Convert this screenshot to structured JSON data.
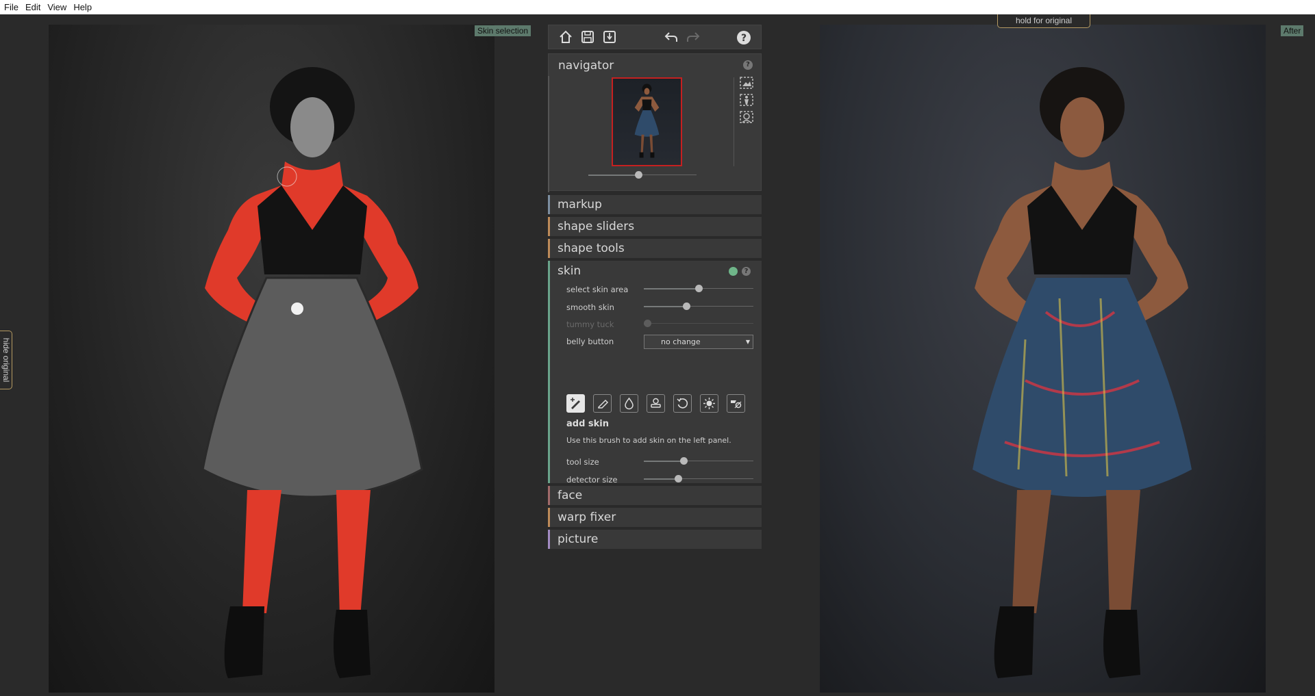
{
  "menu": [
    "File",
    "Edit",
    "View",
    "Help"
  ],
  "labels": {
    "skin_selection": "Skin selection",
    "after": "After",
    "hold_original": "hold for original",
    "hide_original": "hide original"
  },
  "panel": {
    "navigator": {
      "title": "navigator",
      "zoom_level": 0.46
    },
    "sections": {
      "markup": "markup",
      "shape_sliders": "shape sliders",
      "shape_tools": "shape tools",
      "skin": "skin",
      "face": "face",
      "warp_fixer": "warp fixer",
      "picture": "picture"
    },
    "skin": {
      "select_skin_area": {
        "label": "select skin area",
        "value": 0.5
      },
      "smooth_skin": {
        "label": "smooth skin",
        "value": 0.39
      },
      "tummy_tuck": {
        "label": "tummy tuck",
        "value": 0.03,
        "disabled": true
      },
      "belly_button": {
        "label": "belly button",
        "value": "no change"
      },
      "tool": {
        "name": "add skin",
        "description": "Use this brush to add skin on the left panel."
      },
      "tool_size": {
        "label": "tool size",
        "value": 0.36
      },
      "detector_size": {
        "label": "detector size",
        "value": 0.31
      }
    }
  },
  "colors": {
    "skin_mask": "#e03a2a",
    "skin_accent": "#6aa38a",
    "navigator_frame": "#c62020"
  }
}
